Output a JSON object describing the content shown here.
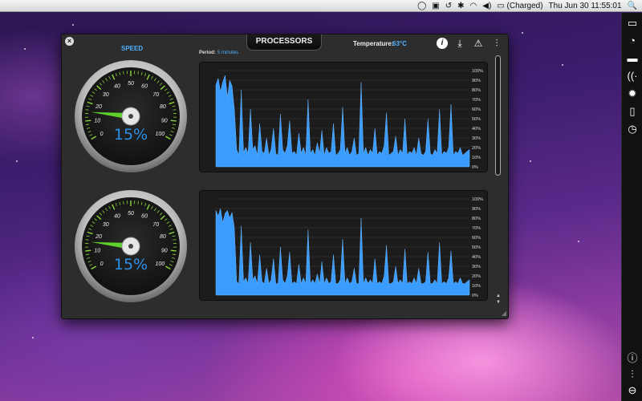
{
  "menubar": {
    "status_icons": [
      "chat-bubble-icon",
      "display-icon",
      "time-machine-icon",
      "bluetooth-icon",
      "wifi-icon",
      "volume-icon"
    ],
    "battery_text": "(Charged)",
    "datetime": "Thu Jun 30  11:55:01",
    "spotlight": "🔍"
  },
  "window": {
    "title": "PROCESSORS",
    "temperature_label": "Temperature:",
    "temperature_value": "63°C",
    "speed_label": "SPEED",
    "period_label": "Period:",
    "period_value": "5 minutes"
  },
  "gauges": [
    {
      "value_text": "15%",
      "value": 15,
      "ticks": [
        "0",
        "10",
        "20",
        "30",
        "40",
        "50",
        "60",
        "70",
        "80",
        "90",
        "100"
      ]
    },
    {
      "value_text": "15%",
      "value": 15,
      "ticks": [
        "0",
        "10",
        "20",
        "30",
        "40",
        "50",
        "60",
        "70",
        "80",
        "90",
        "100"
      ]
    }
  ],
  "chart_data": [
    {
      "type": "area",
      "y_ticks": [
        "100%",
        "90%",
        "80%",
        "70%",
        "60%",
        "50%",
        "40%",
        "30%",
        "20%",
        "10%",
        "0%"
      ],
      "ylim": [
        0,
        100
      ],
      "grid": true,
      "color": "#3a9cff",
      "values": [
        85,
        92,
        78,
        88,
        95,
        72,
        90,
        84,
        60,
        18,
        12,
        80,
        15,
        20,
        14,
        60,
        18,
        22,
        12,
        45,
        16,
        14,
        30,
        12,
        18,
        40,
        14,
        12,
        55,
        18,
        14,
        22,
        48,
        14,
        16,
        12,
        35,
        14,
        20,
        12,
        70,
        14,
        18,
        12,
        25,
        14,
        38,
        12,
        20,
        14,
        16,
        45,
        12,
        14,
        18,
        62,
        14,
        20,
        12,
        16,
        30,
        12,
        14,
        88,
        14,
        20,
        12,
        18,
        14,
        40,
        12,
        16,
        14,
        22,
        56,
        12,
        14,
        16,
        32,
        12,
        18,
        14,
        50,
        12,
        16,
        14,
        20,
        12,
        30,
        14,
        12,
        16,
        50,
        14,
        12,
        18,
        14,
        60,
        12,
        16,
        14,
        20,
        65,
        12,
        16,
        14,
        20,
        12,
        14,
        16,
        18
      ]
    },
    {
      "type": "area",
      "y_ticks": [
        "100%",
        "90%",
        "80%",
        "70%",
        "60%",
        "50%",
        "40%",
        "30%",
        "20%",
        "10%",
        "0%"
      ],
      "ylim": [
        0,
        100
      ],
      "grid": true,
      "color": "#3a9cff",
      "values": [
        88,
        82,
        90,
        75,
        85,
        88,
        80,
        86,
        70,
        14,
        12,
        72,
        14,
        18,
        12,
        55,
        16,
        20,
        12,
        42,
        14,
        12,
        28,
        12,
        16,
        38,
        12,
        12,
        50,
        16,
        12,
        20,
        45,
        12,
        14,
        12,
        32,
        12,
        18,
        12,
        68,
        12,
        16,
        12,
        22,
        12,
        35,
        12,
        18,
        12,
        14,
        42,
        12,
        12,
        16,
        58,
        12,
        18,
        12,
        14,
        28,
        12,
        12,
        80,
        12,
        18,
        12,
        16,
        12,
        38,
        12,
        14,
        12,
        20,
        52,
        12,
        12,
        14,
        30,
        12,
        16,
        12,
        48,
        12,
        14,
        12,
        18,
        12,
        28,
        12,
        12,
        14,
        45,
        12,
        12,
        16,
        12,
        55,
        12,
        14,
        12,
        18,
        46,
        12,
        14,
        12,
        18,
        12,
        12,
        14,
        16
      ]
    }
  ],
  "sidebar": {
    "icons": [
      "display-icon",
      "speedometer-icon",
      "memory-icon",
      "network-icon",
      "gear-icon",
      "document-icon",
      "clock-icon"
    ],
    "bottom_icons": [
      "info-icon",
      "sliders-icon",
      "minus-icon"
    ]
  }
}
